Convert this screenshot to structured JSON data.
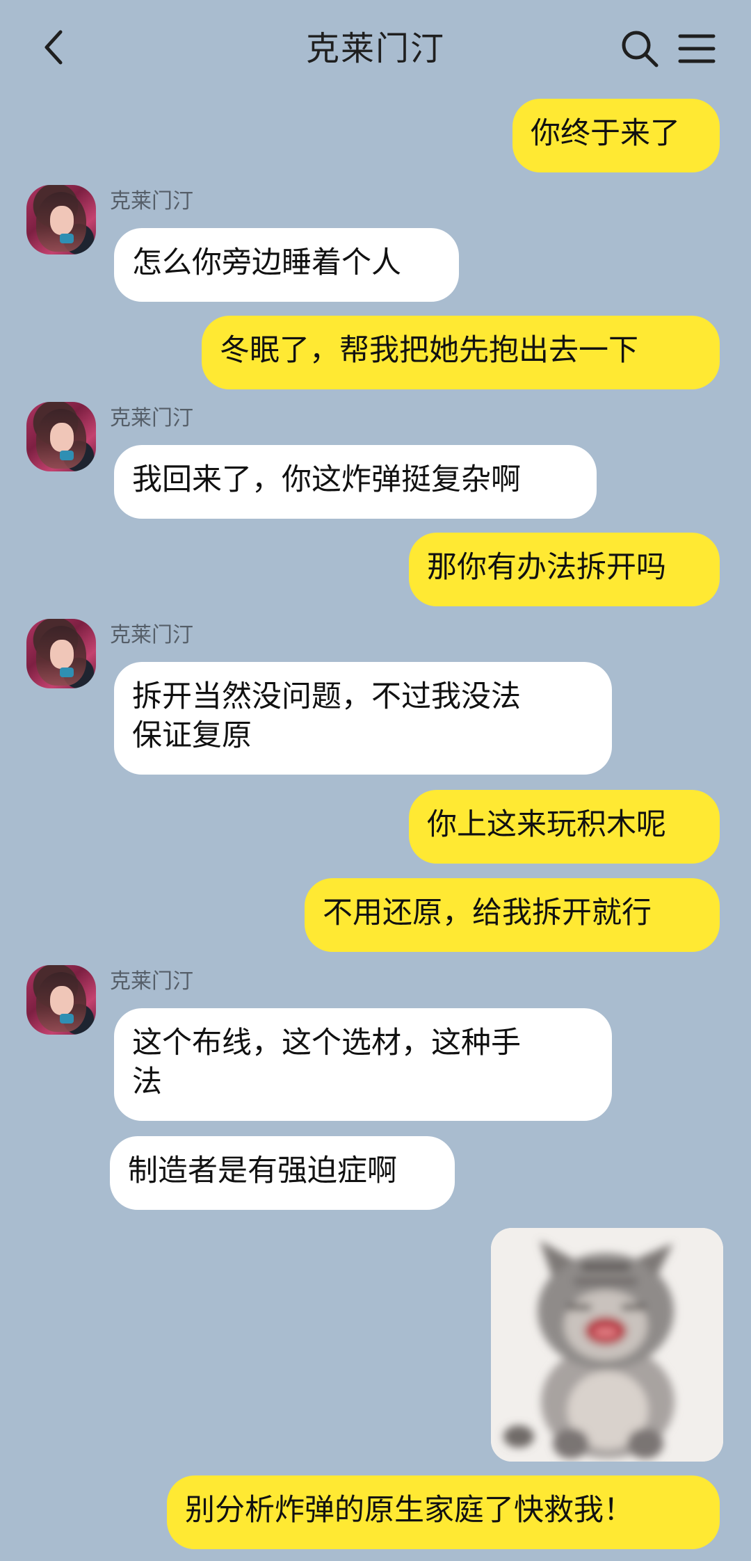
{
  "header": {
    "title": "克莱门汀"
  },
  "messages": [
    {
      "side": "out",
      "text": "你终于来了"
    },
    {
      "side": "in",
      "sender": "克莱门汀",
      "text": "怎么你旁边睡着个人"
    },
    {
      "side": "out",
      "text": "冬眠了，帮我把她先抱出去一下"
    },
    {
      "side": "in",
      "sender": "克莱门汀",
      "text": "我回来了，你这炸弹挺复杂啊"
    },
    {
      "side": "out",
      "text": "那你有办法拆开吗"
    },
    {
      "side": "in",
      "sender": "克莱门汀",
      "text": "拆开当然没问题，不过我没法\n保证复原"
    },
    {
      "side": "out",
      "text": "你上这来玩积木呢"
    },
    {
      "side": "out",
      "text": "不用还原，给我拆开就行"
    },
    {
      "side": "in",
      "sender": "克莱门汀",
      "text": "这个布线，这个选材，这种手\n法"
    },
    {
      "side": "in",
      "text": "制造者是有强迫症啊"
    },
    {
      "side": "out",
      "type": "sticker",
      "sticker": "crying-cat-sticker"
    },
    {
      "side": "out",
      "text": "别分析炸弹的原生家庭了快救我！"
    }
  ],
  "colors": {
    "background": "#a9bccf",
    "incoming_bubble": "#ffffff",
    "outgoing_bubble": "#ffe933",
    "text": "#111111",
    "name": "#555e68"
  },
  "icons": {
    "back": "chevron-left-icon",
    "search": "search-icon",
    "menu": "menu-icon"
  }
}
